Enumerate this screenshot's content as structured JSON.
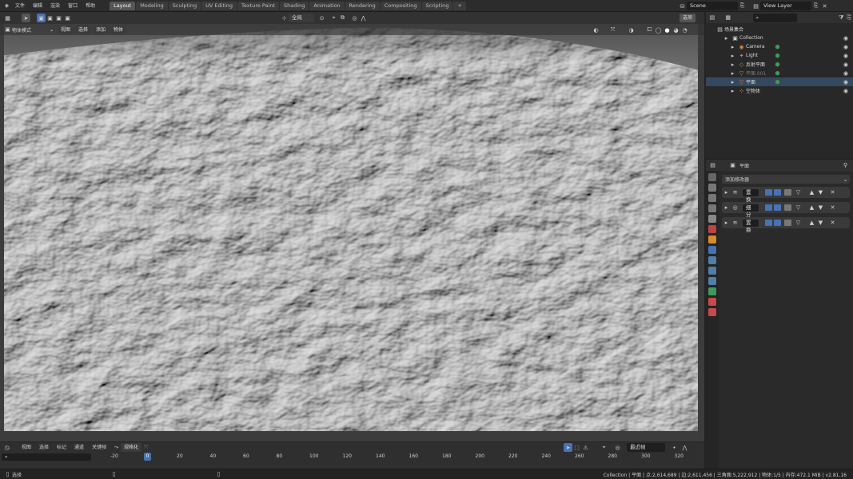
{
  "topbar": {
    "menus": [
      "文件",
      "编辑",
      "渲染",
      "窗口",
      "帮助"
    ],
    "workspaces": [
      "Layout",
      "Modeling",
      "Sculpting",
      "UV Editing",
      "Texture Paint",
      "Shading",
      "Animation",
      "Rendering",
      "Compositing",
      "Scripting"
    ],
    "active_workspace": "Layout",
    "add_tab": "+",
    "scene_name": "Scene",
    "view_layer": "View Layer"
  },
  "viewport": {
    "mode": "物体模式",
    "menus": [
      "视图",
      "选择",
      "添加",
      "物体"
    ],
    "transform_orientation": "全局",
    "options": "选项"
  },
  "outliner": {
    "root": "场景集合",
    "items": [
      {
        "label": "Collection",
        "icon": "collection-icon",
        "extra_color": ""
      },
      {
        "label": "Camera",
        "icon": "camera-icon",
        "extra_color": "#3e9a5a"
      },
      {
        "label": "Light",
        "icon": "light-icon",
        "extra_color": "#3e9a5a"
      },
      {
        "label": "反射平面",
        "icon": "reflection-plane-icon",
        "extra_color": "#3e9a5a"
      },
      {
        "label": "平面.001",
        "icon": "mesh-icon",
        "extra_color": "#3e9a5a"
      },
      {
        "label": "平面",
        "icon": "mesh-icon",
        "extra_color": "#3e9a5a"
      },
      {
        "label": "空物体",
        "icon": "empty-icon",
        "extra_color": ""
      }
    ]
  },
  "properties": {
    "object_name": "平面",
    "add_modifier": "添加修改器",
    "modifiers": [
      {
        "name": "置换",
        "icon": "displace-icon"
      },
      {
        "name": "细分",
        "icon": "subdivision-icon"
      },
      {
        "name": "置换",
        "icon": "displace-icon"
      }
    ]
  },
  "timeline": {
    "menus": [
      "视图",
      "选择",
      "标记",
      "通道",
      "关键帧"
    ],
    "interpolation": "规格化",
    "snap": "最近帧",
    "ticks": [
      "-20",
      "0",
      "20",
      "40",
      "60",
      "80",
      "100",
      "120",
      "140",
      "160",
      "180",
      "200",
      "220",
      "240",
      "260",
      "280",
      "300",
      "320"
    ],
    "current_frame": "0"
  },
  "status": {
    "left": "选择",
    "right": "Collection | 平面 | 点:2,614,689 | 边:2,611,456 | 三角面:5,222,912 | 物体:1/5 | 内存:472.1 MiB | v2.81.16"
  },
  "colors": {
    "accent": "#4772b3",
    "selected_row": "#34495f",
    "mesh_orange": "#e0863a",
    "green": "#3e9a5a"
  }
}
